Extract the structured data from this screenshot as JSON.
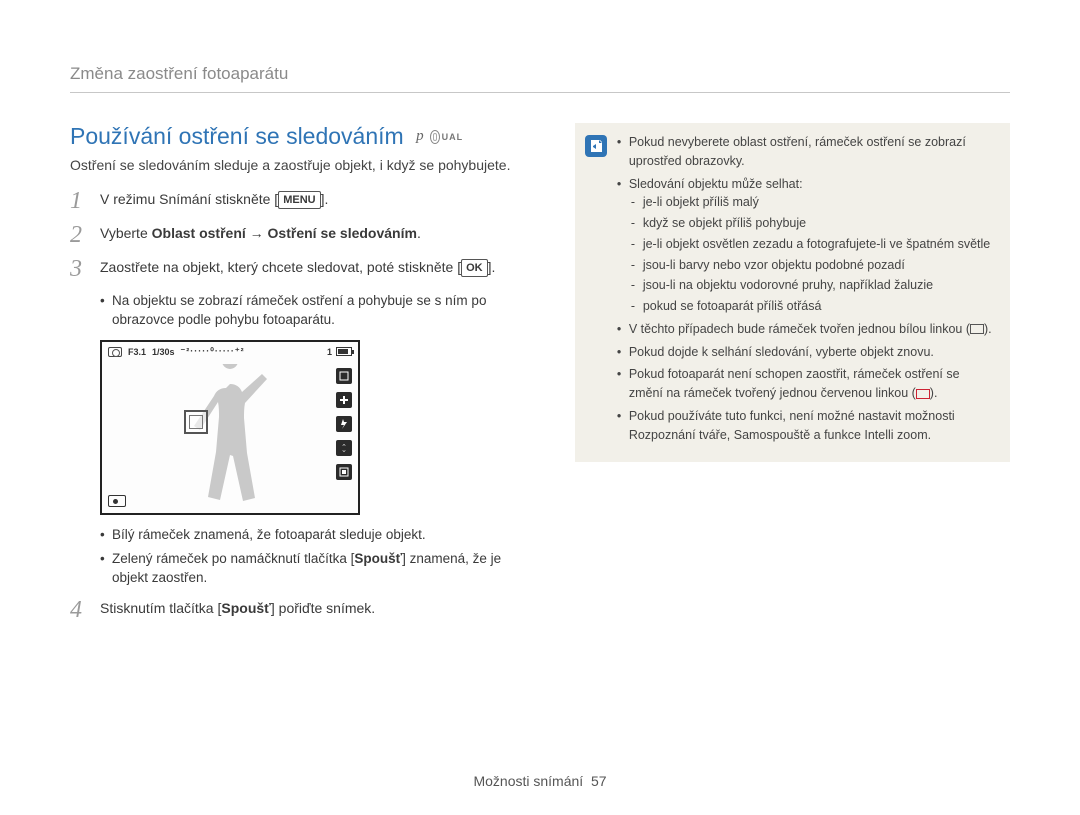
{
  "breadcrumb": "Změna zaostření fotoaparátu",
  "section_title": "Používání ostření se sledováním",
  "mode_p": "p",
  "mode_dual": "UAL",
  "intro": "Ostření se sledováním sleduje a zaostřuje objekt, i když se pohybujete.",
  "steps": {
    "s1": {
      "num": "1",
      "pre": "V režimu Snímání stiskněte [",
      "btn": "MENU",
      "post": "]."
    },
    "s2": {
      "num": "2",
      "pre": "Vyberte ",
      "b1": "Oblast ostření",
      "arrow": " → ",
      "b2": "Ostření se sledováním",
      "post": "."
    },
    "s3": {
      "num": "3",
      "pre": "Zaostřete na objekt, který chcete sledovat, poté stiskněte [",
      "btn": "OK",
      "post": "]."
    },
    "s3_b1": "Na objektu se zobrazí rámeček ostření a pohybuje se s ním po obrazovce podle pohybu fotoaparátu.",
    "s3_c1": "Bílý rámeček znamená, že fotoaparát sleduje objekt.",
    "s3_c2_pre": "Zelený rámeček po namáčknutí tlačítka [",
    "s3_c2_b": "Spoušť",
    "s3_c2_post": "] znamená, že je objekt zaostřen.",
    "s4": {
      "num": "4",
      "pre": "Stisknutím tlačítka [",
      "b": "Spoušť",
      "post": "] pořiďte snímek."
    }
  },
  "lcd": {
    "aperture": "F3.1",
    "shutter": "1/30s",
    "ev_scale": "⁻²·····⁰·····⁺²",
    "count": "1"
  },
  "note": {
    "n1": "Pokud nevyberete oblast ostření, rámeček ostření se zobrazí uprostřed obrazovky.",
    "n2": "Sledování objektu může selhat:",
    "n2a": "je-li objekt příliš malý",
    "n2b": "když se objekt příliš pohybuje",
    "n2c": "je-li objekt osvětlen zezadu a fotografujete-li ve špatném světle",
    "n2d": "jsou-li barvy nebo vzor objektu podobné pozadí",
    "n2e": "jsou-li na objektu vodorovné pruhy, například žaluzie",
    "n2f": "pokud se fotoaparát příliš otřásá",
    "n3_pre": "V těchto případech bude rámeček tvořen jednou bílou linkou (",
    "n3_post": ").",
    "n4": "Pokud dojde k selhání sledování, vyberte objekt znovu.",
    "n5_pre": "Pokud fotoaparát není schopen zaostřit, rámeček ostření se změní na rámeček tvořený jednou červenou linkou (",
    "n5_post": ").",
    "n6": "Pokud používáte tuto funkci, není možné nastavit možnosti Rozpoznání tváře, Samospouště a funkce Intelli zoom."
  },
  "footer_label": "Možnosti snímání",
  "footer_page": "57"
}
